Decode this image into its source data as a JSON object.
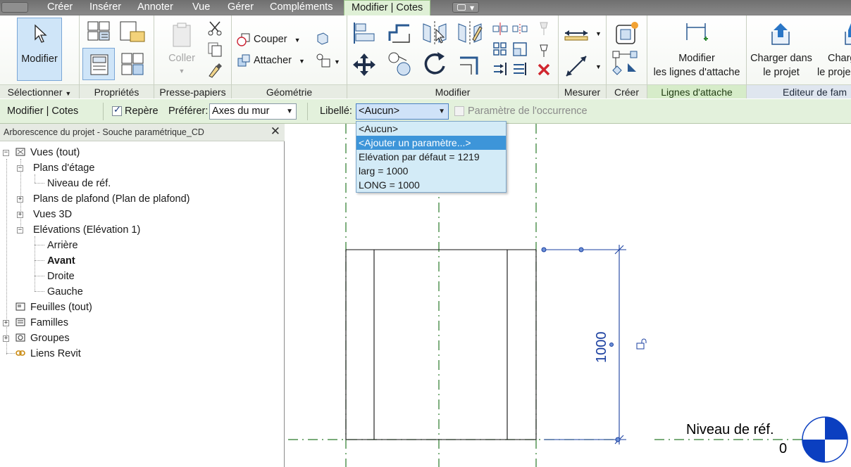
{
  "ribbon": {
    "tabs": [
      "Créer",
      "Insérer",
      "Annoter",
      "Vue",
      "Gérer",
      "Compléments"
    ],
    "active_tab": "Modifier | Cotes",
    "panels": {
      "select": "Sélectionner",
      "properties": "Propriétés",
      "clipboard": "Presse-papiers",
      "geometry": "Géométrie",
      "modify": "Modifier",
      "measure": "Mesurer",
      "create": "Créer",
      "attach_lines": "Lignes d'attache",
      "family_editor": "Editeur de fam"
    },
    "buttons": {
      "modify": "Modifier",
      "paste": "Coller",
      "cut": "Couper",
      "join": "Attacher",
      "modify_lines_l1": "Modifier",
      "modify_lines_l2": "les lignes d'attache",
      "load_project_l1": "Charger dans",
      "load_project_l2": "le projet",
      "load_project2_l1": "Charg",
      "load_project2_l2": "le proje"
    }
  },
  "options_bar": {
    "context": "Modifier | Cotes",
    "reference_label": "Repère",
    "reference_checked": true,
    "prefer_label": "Préférer:",
    "prefer_value": "Axes du mur",
    "label_label": "Libellé:",
    "label_value": "<Aucun>",
    "instance_param_label": "Paramètre de l'occurrence",
    "instance_param_checked": false
  },
  "label_dropdown": {
    "items": [
      "<Aucun>",
      "<Ajouter un paramètre...>",
      "Elévation par défaut = 1219",
      "larg = 1000",
      "LONG = 1000"
    ],
    "highlighted_index": 1
  },
  "project_browser": {
    "title": "Arborescence du projet - Souche paramétrique_CD",
    "close": "✕",
    "tree": {
      "views": "Vues (tout)",
      "floor_plans": "Plans d'étage",
      "ref_level": "Niveau de réf.",
      "ceiling_plans": "Plans de plafond (Plan de plafond)",
      "views_3d": "Vues 3D",
      "elevations": "Elévations (Elévation 1)",
      "back": "Arrière",
      "front": "Avant",
      "right": "Droite",
      "left": "Gauche",
      "sheets": "Feuilles (tout)",
      "families": "Familles",
      "groups": "Groupes",
      "revit_links": "Liens Revit"
    }
  },
  "canvas": {
    "dimension_value": "1000",
    "level_name": "Niveau de réf.",
    "level_elevation": "0",
    "colors": {
      "dimension": "#1a3fa0",
      "reference_plane": "#2a7a2a",
      "level_head": "#0b3fc0"
    }
  }
}
